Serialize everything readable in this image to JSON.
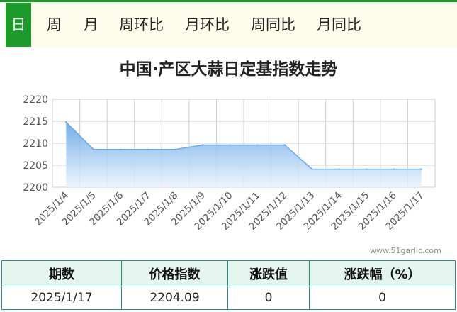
{
  "tabs": [
    {
      "label": "日",
      "active": true
    },
    {
      "label": "周"
    },
    {
      "label": "月"
    },
    {
      "label": "周环比"
    },
    {
      "label": "月环比"
    },
    {
      "label": "周同比"
    },
    {
      "label": "月同比"
    }
  ],
  "colors": {
    "accent": "#1e9a2c",
    "table_border": "#2a8c86",
    "area_top": "#6aa8e6",
    "line": "#6aa8e6"
  },
  "chart_data": {
    "type": "area",
    "title": "中国·产区大蒜日定基指数走势",
    "categories": [
      "2025/1/4",
      "2025/1/5",
      "2025/1/6",
      "2025/1/7",
      "2025/1/8",
      "2025/1/9",
      "2025/1/10",
      "2025/1/11",
      "2025/1/12",
      "2025/1/13",
      "2025/1/14",
      "2025/1/15",
      "2025/1/16",
      "2025/1/17"
    ],
    "values": [
      2214.8,
      2208.6,
      2208.6,
      2208.6,
      2208.6,
      2209.6,
      2209.6,
      2209.6,
      2209.6,
      2204.1,
      2204.1,
      2204.1,
      2204.1,
      2204.1
    ],
    "ylim": [
      2200,
      2220
    ],
    "yticks": [
      2200,
      2205,
      2210,
      2215,
      2220
    ],
    "grid": true,
    "xlabel": "",
    "ylabel": ""
  },
  "watermark": "www.51garlic.com",
  "table": {
    "headers": [
      "期数",
      "价格指数",
      "涨跌值",
      "涨跌幅（%）"
    ],
    "row": [
      "2025/1/17",
      "2204.09",
      "0",
      "0"
    ]
  }
}
